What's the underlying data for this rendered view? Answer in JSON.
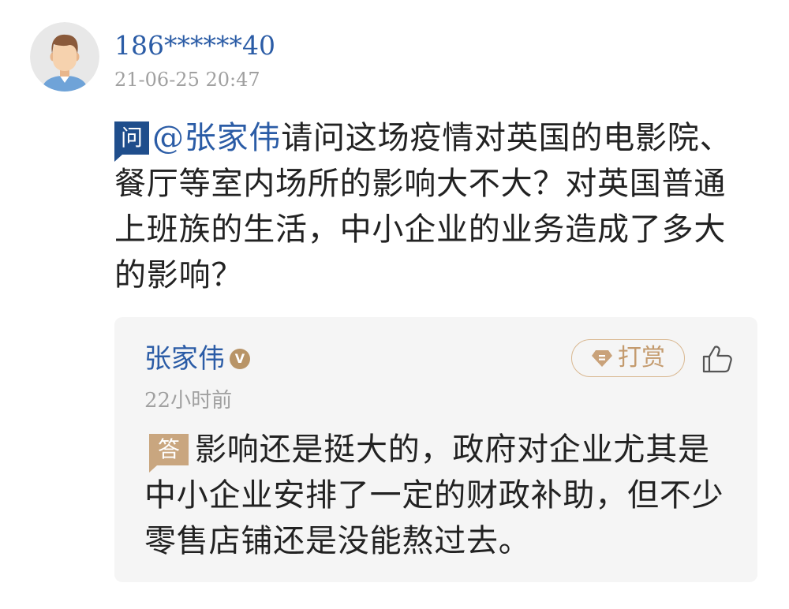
{
  "post": {
    "avatar_icon": "user-avatar-icon",
    "username": "186******40",
    "timestamp": "21-06-25 20:47"
  },
  "question": {
    "badge": "问",
    "mention": "@张家伟",
    "lines": [
      "请问这场疫情对英国的电影院、",
      "餐厅等室内场所的影响大不大？对英国普通",
      "上班族的生活，中小企业的业务造成了多大",
      "的影响？"
    ]
  },
  "reply": {
    "author": "张家伟",
    "verified_badge": "V",
    "tip_icon": "gem-icon",
    "tip_label": "打赏",
    "like_icon": "thumbs-up-icon",
    "time": "22小时前",
    "badge": "答",
    "lines": [
      "影响还是挺大的，政府对企业尤其是",
      "中小企业安排了一定的财政补助，但不少",
      "零售店铺还是没能熬过去。"
    ]
  },
  "colors": {
    "link_blue": "#2b5ca6",
    "question_badge": "#1f4e8c",
    "answer_badge": "#c9a67f",
    "tip_accent": "#c49b6e",
    "muted_text": "#a0a0a0",
    "reply_background": "#f5f5f5"
  }
}
